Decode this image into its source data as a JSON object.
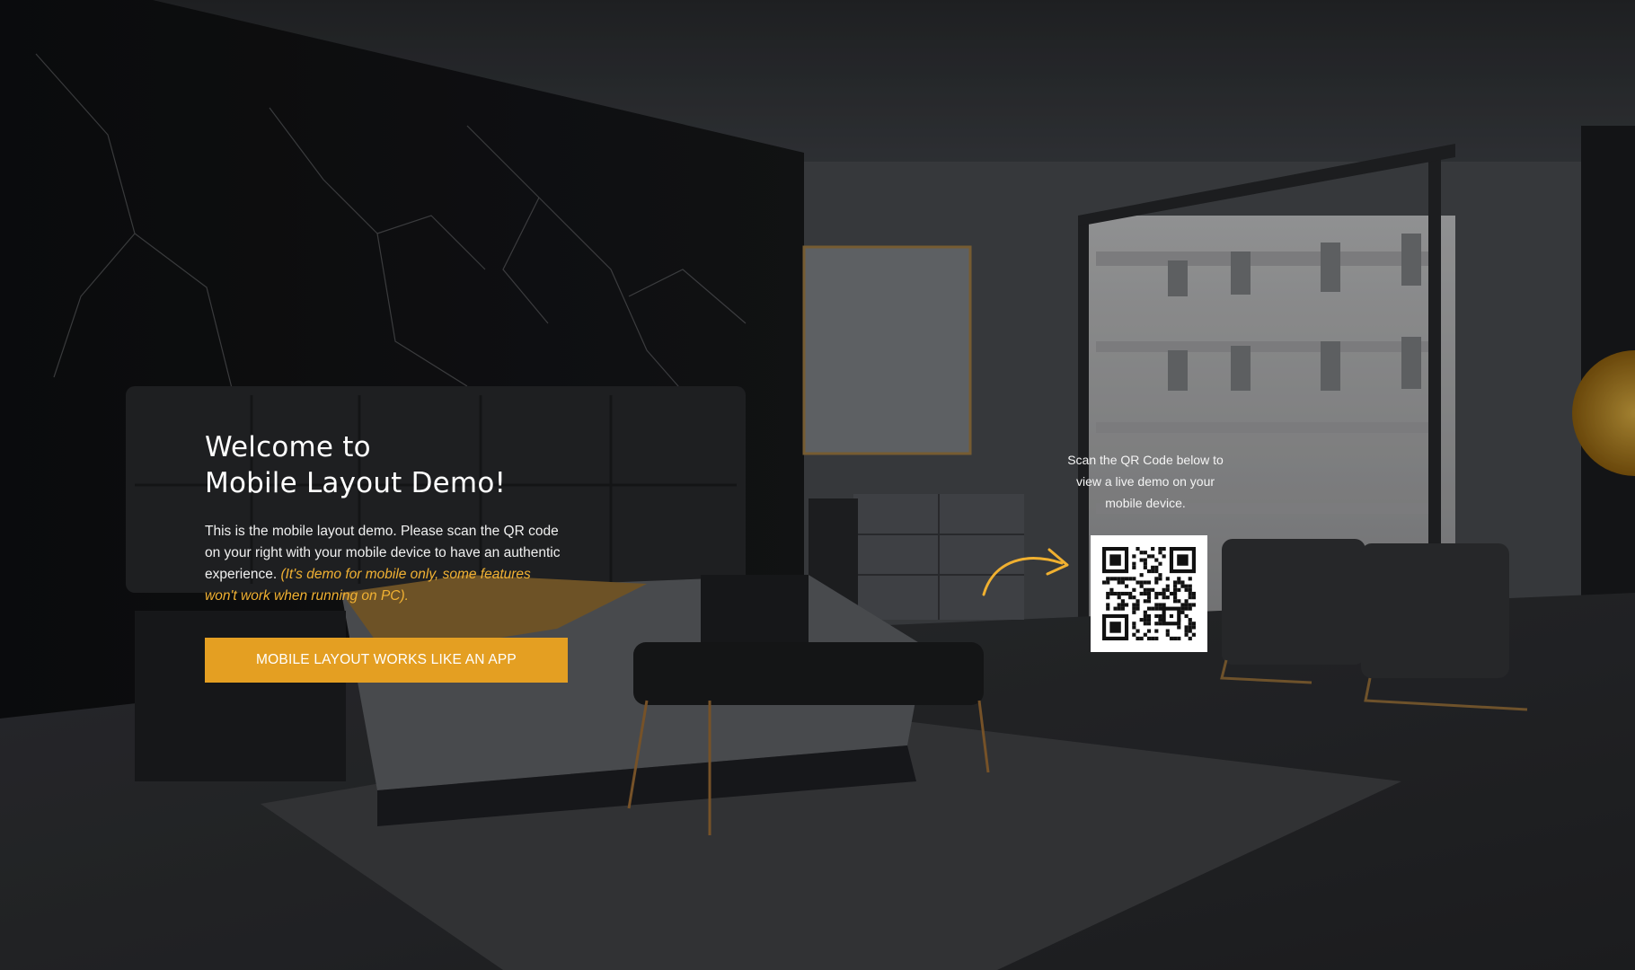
{
  "hero": {
    "title_line1": "Welcome to",
    "title_line2": "Mobile Layout Demo!",
    "description": "This is the mobile layout demo. Please scan the QR code on your right with your mobile device to have an authentic experience. ",
    "note": "(It's demo for mobile only, some features won't work when running on PC).",
    "cta_label": "MOBILE LAYOUT WORKS LIKE AN APP"
  },
  "qr": {
    "caption": "Scan the QR Code below to view a live demo on your mobile device."
  },
  "colors": {
    "accent": "#e49f22",
    "note_text": "#f2b233"
  },
  "icons": {
    "arrow": "curved-arrow-icon",
    "qr": "qr-code-icon"
  }
}
